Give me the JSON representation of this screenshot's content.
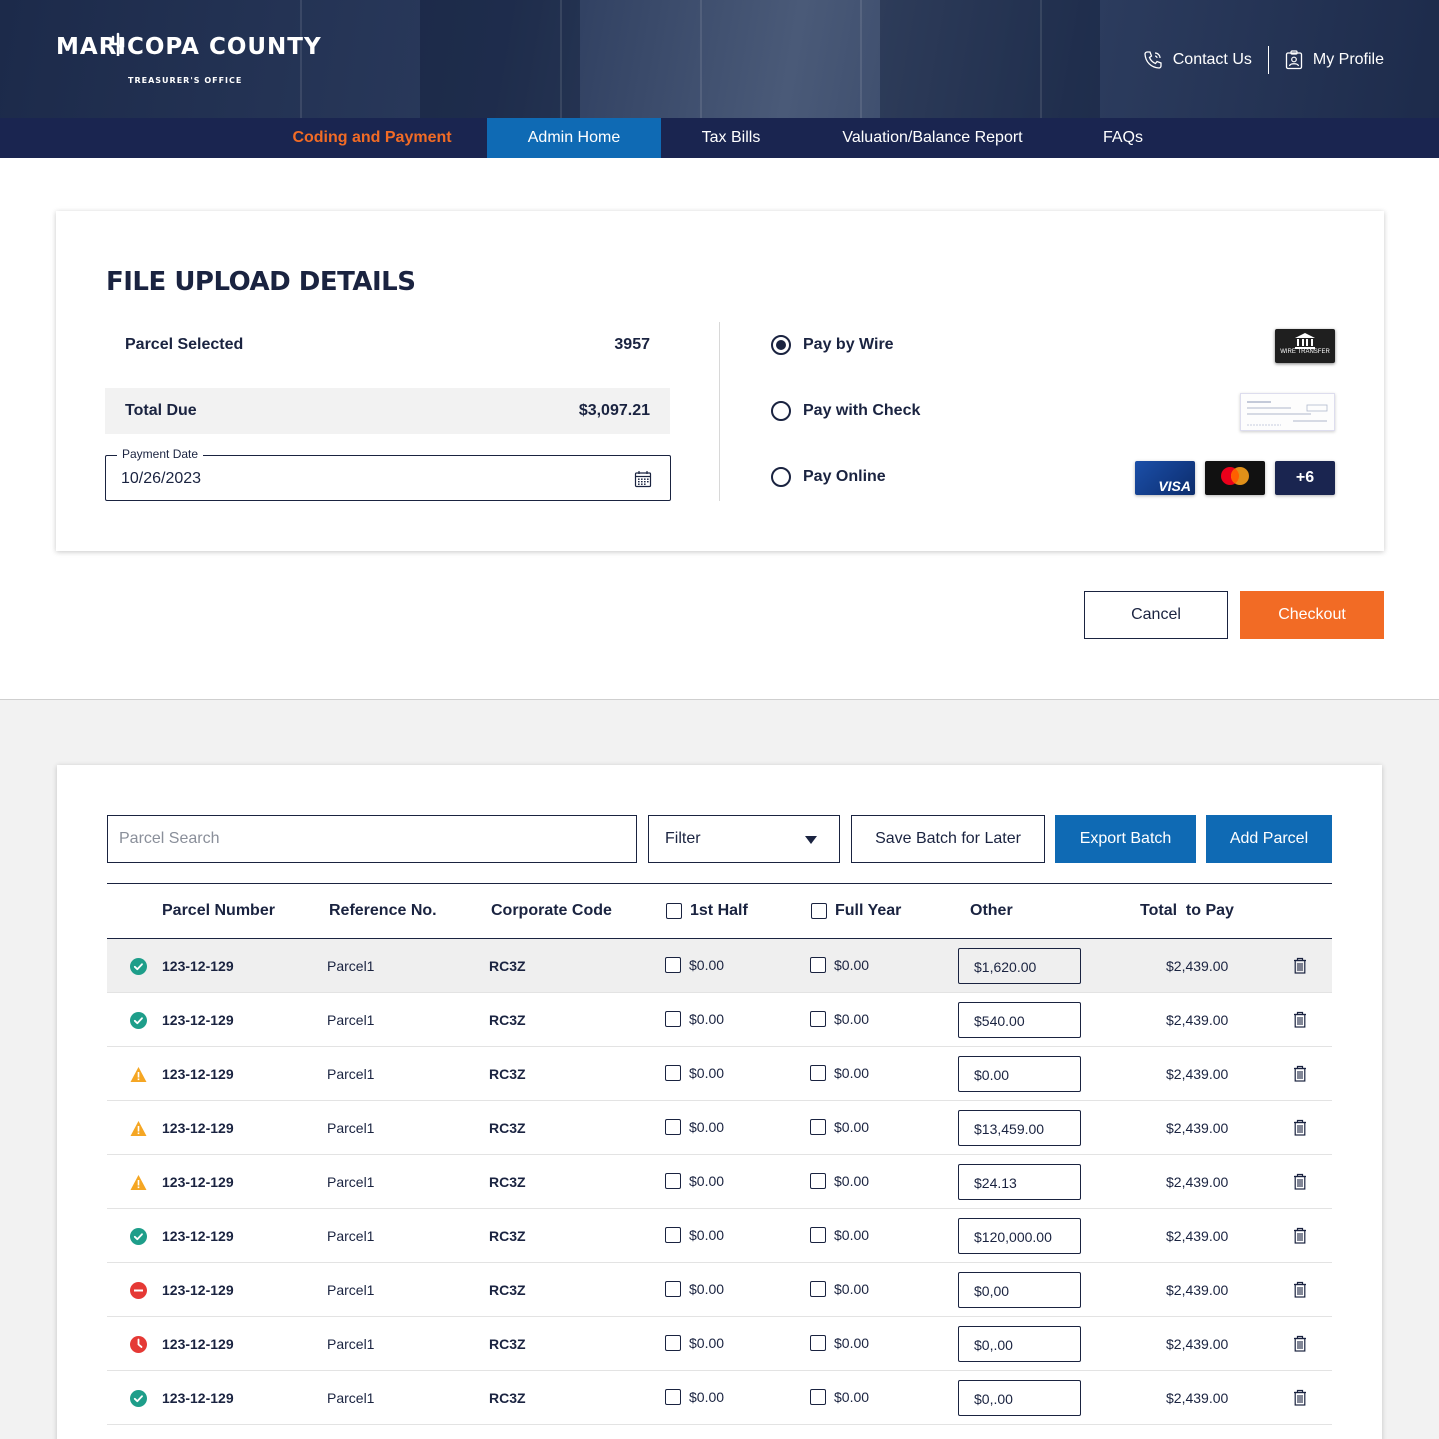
{
  "header": {
    "logo_main": "MARICOPA COUNTY",
    "logo_sub": "TREASURER'S OFFICE",
    "contact_label": "Contact Us",
    "profile_label": "My Profile"
  },
  "nav": {
    "items": [
      "Coding and Payment",
      "Admin Home",
      "Tax Bills",
      "Valuation/Balance Report",
      "FAQs"
    ]
  },
  "upload": {
    "title": "FILE UPLOAD DETAILS",
    "parcel_selected_label": "Parcel Selected",
    "parcel_selected_value": "3957",
    "total_due_label": "Total Due",
    "total_due_value": "$3,097.21",
    "payment_date_label": "Payment Date",
    "payment_date_value": "10/26/2023",
    "pay_options": [
      "Pay by Wire",
      "Pay with Check",
      "Pay Online"
    ],
    "selected_option": "Pay by Wire",
    "wire_img_text": "WIRE TRANSFER",
    "card_brands": [
      "VISA",
      "mastercard"
    ],
    "more_cards": "+6"
  },
  "actions": {
    "cancel": "Cancel",
    "checkout": "Checkout"
  },
  "batch": {
    "search_placeholder": "Parcel Search",
    "filter_label": "Filter",
    "save_batch": "Save Batch for Later",
    "export_batch": "Export Batch",
    "add_parcel": "Add Parcel",
    "columns": [
      "Parcel Number",
      "Reference No.",
      "Corporate Code",
      "1st Half",
      "Full Year",
      "Other",
      "Total  to Pay"
    ],
    "rows": [
      {
        "status": "ok",
        "parcel": "123-12-129",
        "ref": "Parcel1",
        "code": "RC3Z",
        "first_half": "$0.00",
        "full_year": "$0.00",
        "other": "$1,620.00",
        "total": "$2,439.00"
      },
      {
        "status": "ok",
        "parcel": "123-12-129",
        "ref": "Parcel1",
        "code": "RC3Z",
        "first_half": "$0.00",
        "full_year": "$0.00",
        "other": "$540.00",
        "total": "$2,439.00"
      },
      {
        "status": "warning",
        "parcel": "123-12-129",
        "ref": "Parcel1",
        "code": "RC3Z",
        "first_half": "$0.00",
        "full_year": "$0.00",
        "other": "$0.00",
        "total": "$2,439.00"
      },
      {
        "status": "warning",
        "parcel": "123-12-129",
        "ref": "Parcel1",
        "code": "RC3Z",
        "first_half": "$0.00",
        "full_year": "$0.00",
        "other": "$13,459.00",
        "total": "$2,439.00"
      },
      {
        "status": "warning",
        "parcel": "123-12-129",
        "ref": "Parcel1",
        "code": "RC3Z",
        "first_half": "$0.00",
        "full_year": "$0.00",
        "other": "$24.13",
        "total": "$2,439.00"
      },
      {
        "status": "ok",
        "parcel": "123-12-129",
        "ref": "Parcel1",
        "code": "RC3Z",
        "first_half": "$0.00",
        "full_year": "$0.00",
        "other": "$120,000.00",
        "total": "$2,439.00"
      },
      {
        "status": "error",
        "parcel": "123-12-129",
        "ref": "Parcel1",
        "code": "RC3Z",
        "first_half": "$0.00",
        "full_year": "$0.00",
        "other": "$0,00",
        "total": "$2,439.00"
      },
      {
        "status": "pending",
        "parcel": "123-12-129",
        "ref": "Parcel1",
        "code": "RC3Z",
        "first_half": "$0.00",
        "full_year": "$0.00",
        "other": "$0,.00",
        "total": "$2,439.00"
      },
      {
        "status": "ok",
        "parcel": "123-12-129",
        "ref": "Parcel1",
        "code": "RC3Z",
        "first_half": "$0.00",
        "full_year": "$0.00",
        "other": "$0,.00",
        "total": "$2,439.00"
      }
    ]
  },
  "colors": {
    "navy": "#1a2550",
    "orange": "#f26b25",
    "blue": "#0f6ab4",
    "ok": "#1e9e8a",
    "warning": "#f5a623",
    "error": "#e53935"
  }
}
